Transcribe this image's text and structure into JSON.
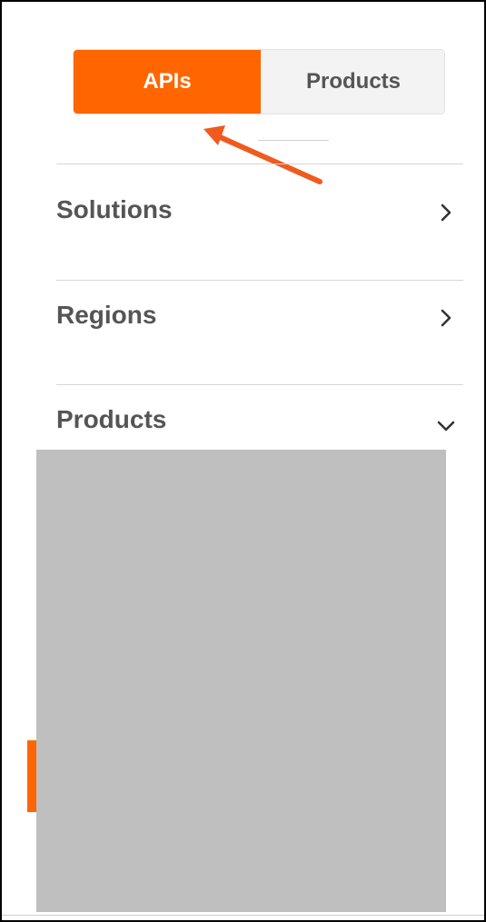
{
  "toggle": {
    "apis_label": "APIs",
    "products_label": "Products",
    "active": "APIs"
  },
  "menu": {
    "items": [
      {
        "label": "Solutions",
        "icon": "chevron-right-icon"
      },
      {
        "label": "Regions",
        "icon": "chevron-right-icon"
      },
      {
        "label": "Products",
        "icon": "chevron-down-icon"
      }
    ]
  },
  "colors": {
    "accent": "#ff6600",
    "annotation_arrow": "#f05a1e",
    "redaction": "#bfbfbf",
    "label_text": "#555555"
  }
}
